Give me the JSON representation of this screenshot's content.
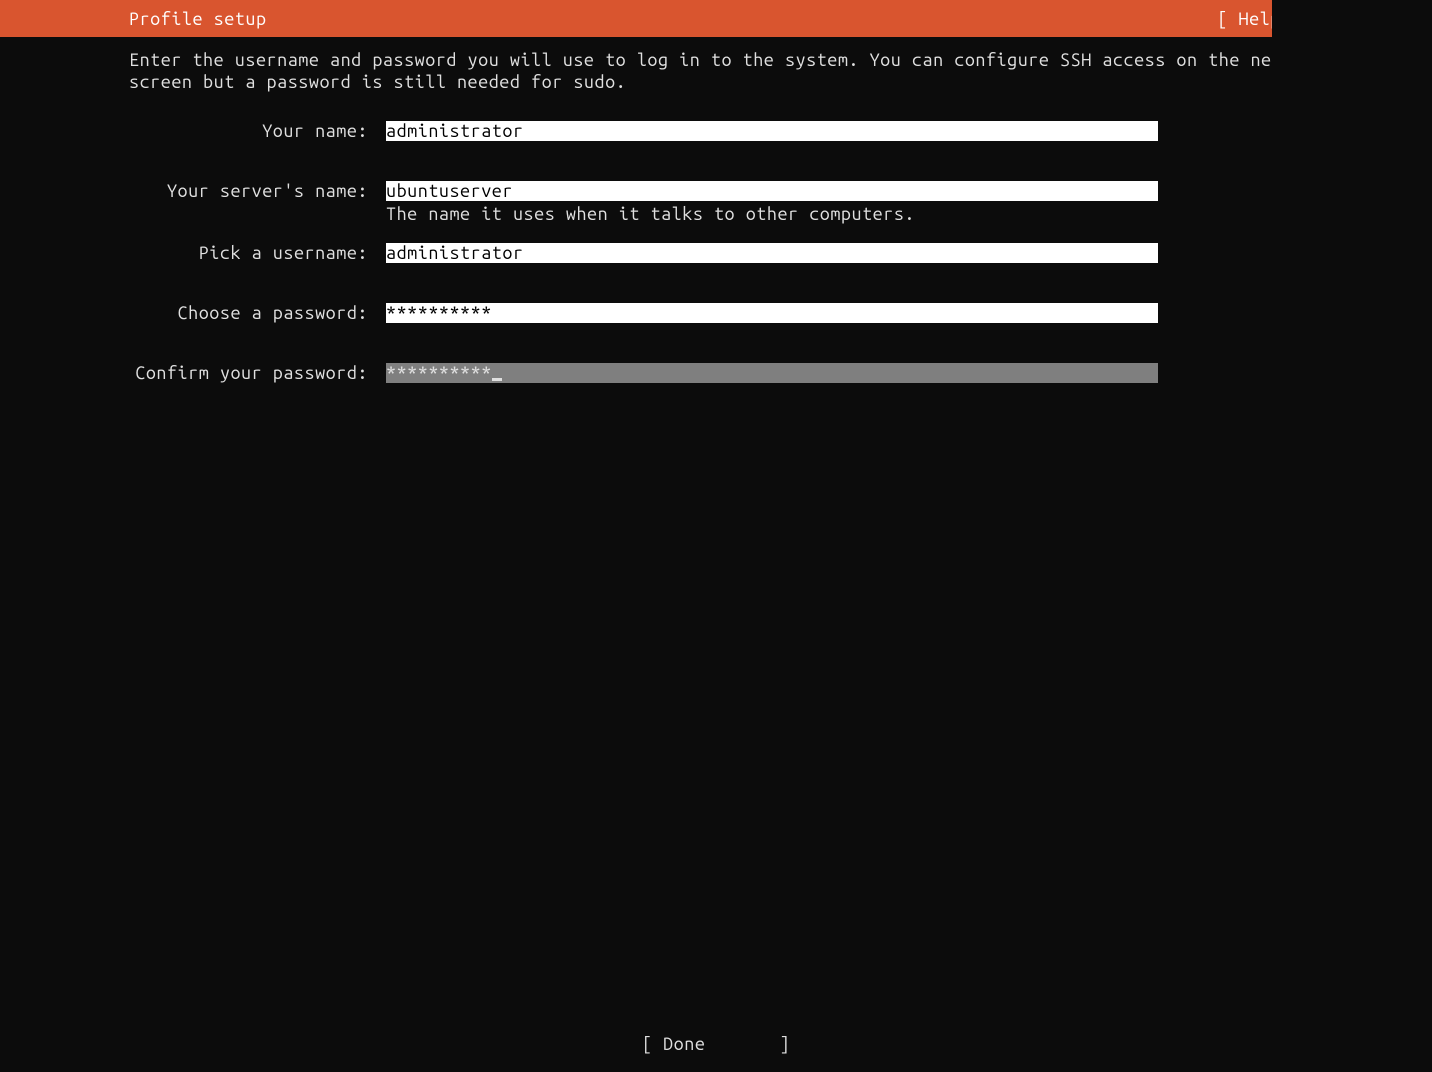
{
  "header": {
    "title": "Profile setup",
    "help": "[ Help ]"
  },
  "instructions": "Enter the username and password you will use to log in to the system. You can configure SSH access on the next screen but a password is still needed for sudo.",
  "form": {
    "name": {
      "label": "Your name:",
      "value": "administrator"
    },
    "server": {
      "label": "Your server's name:",
      "value": "ubuntuserver",
      "hint": "The name it uses when it talks to other computers."
    },
    "username": {
      "label": "Pick a username:",
      "value": "administrator"
    },
    "password": {
      "label": "Choose a password:",
      "value": "**********"
    },
    "confirm": {
      "label": "Confirm your password:",
      "value": "**********"
    }
  },
  "footer": {
    "done": "[ Done       ]"
  }
}
